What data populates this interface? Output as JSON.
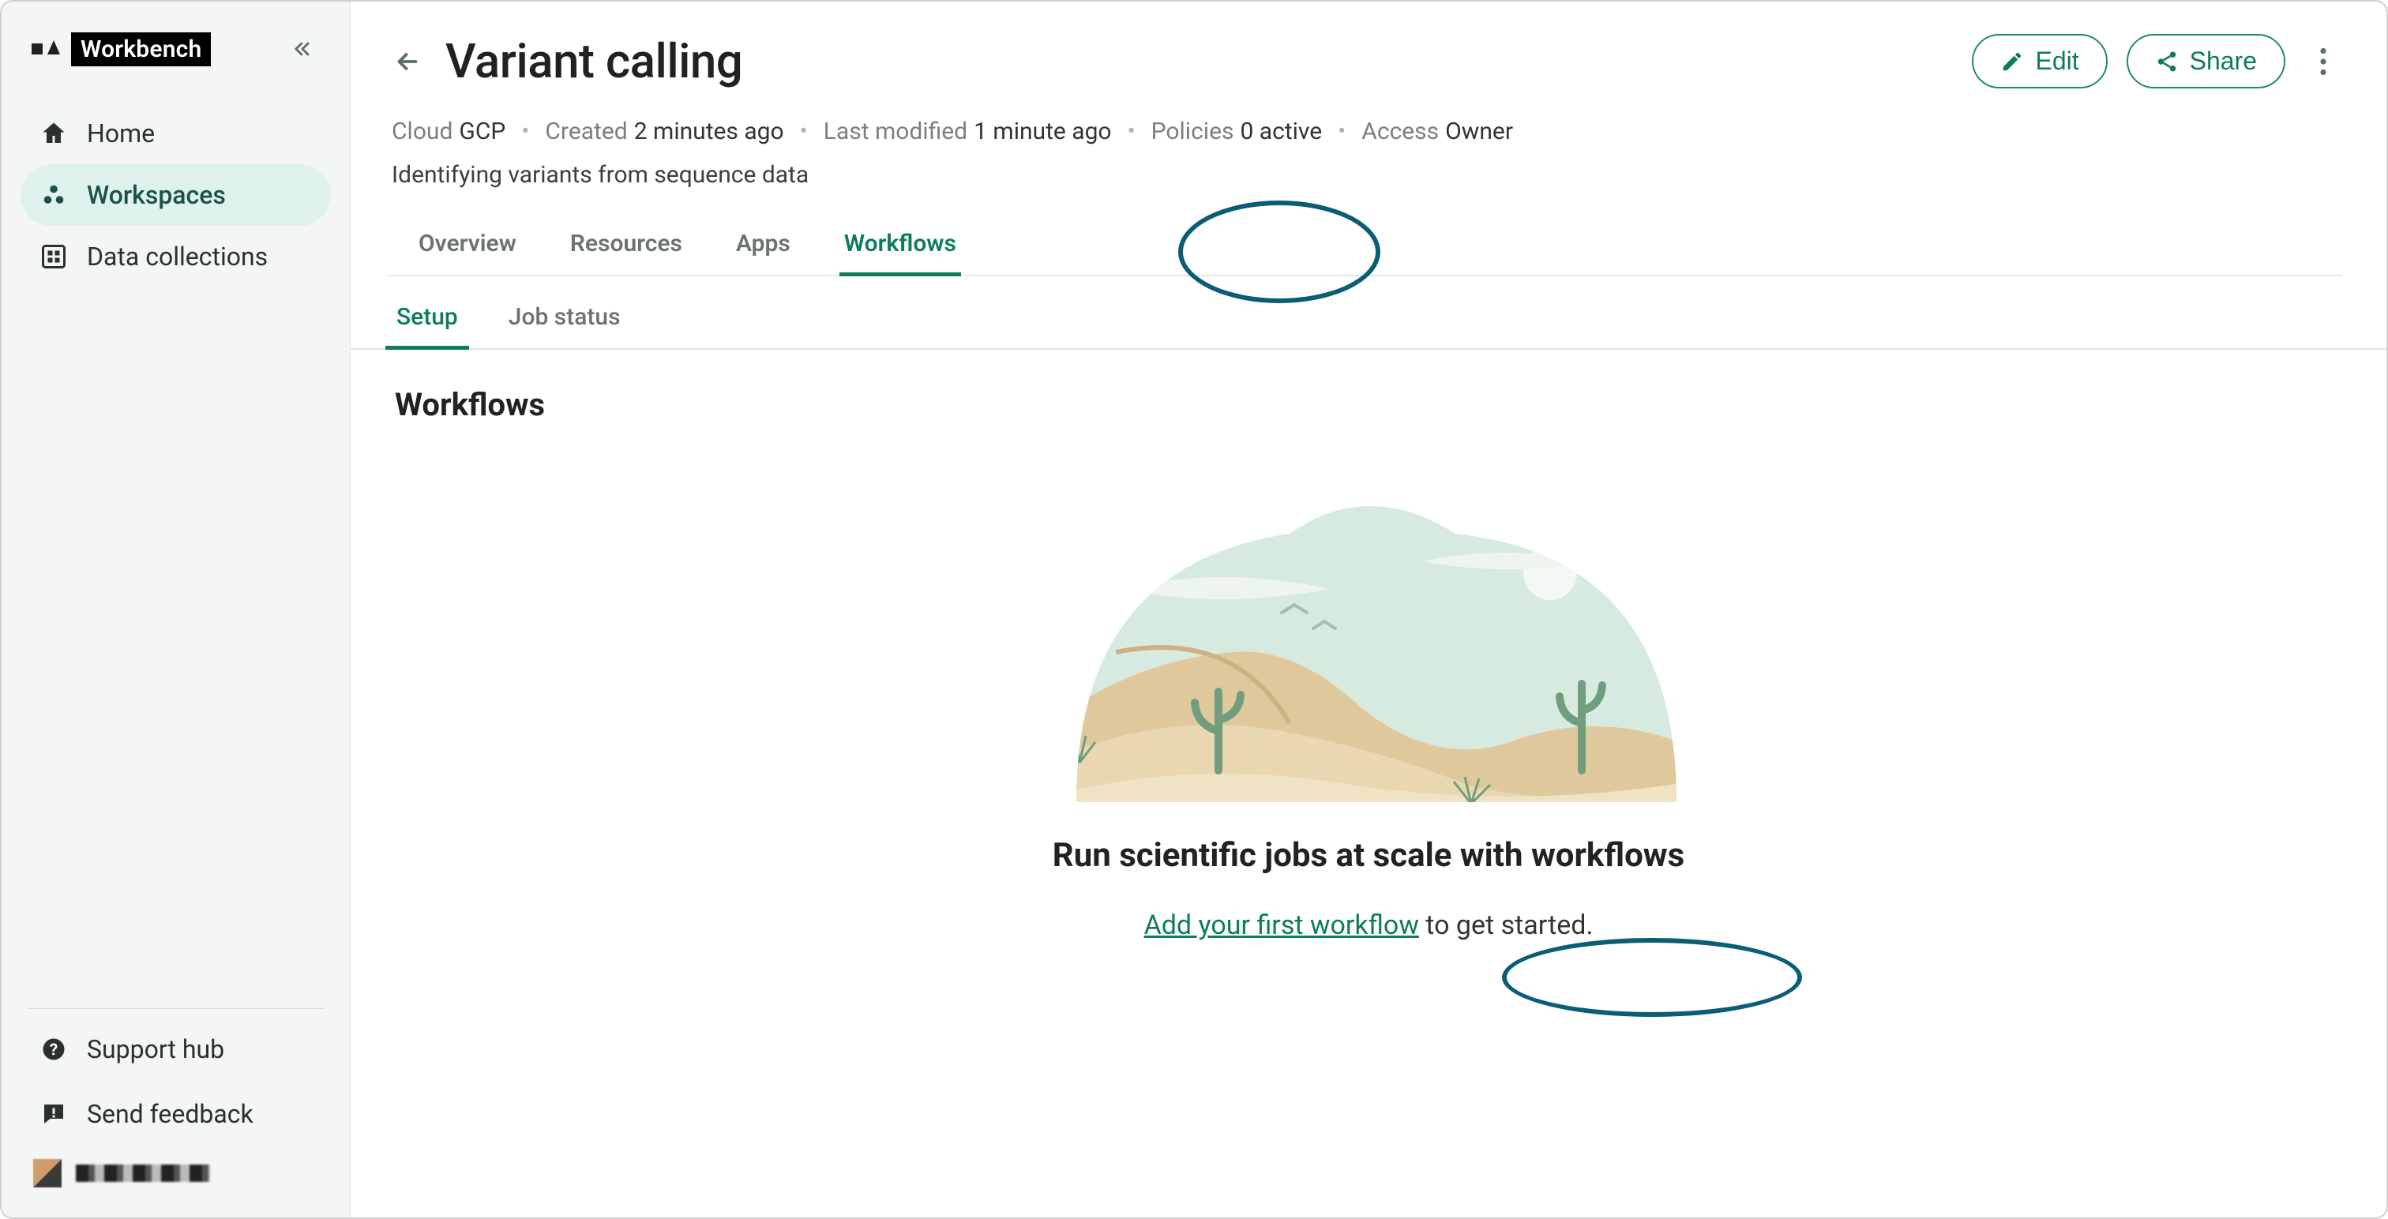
{
  "brand": {
    "badge": "Workbench"
  },
  "sidebar": {
    "items": [
      {
        "label": "Home",
        "icon": "home-icon",
        "active": false
      },
      {
        "label": "Workspaces",
        "icon": "workspaces-icon",
        "active": true
      },
      {
        "label": "Data collections",
        "icon": "grid-icon",
        "active": false
      }
    ],
    "bottom": [
      {
        "label": "Support hub",
        "icon": "help-icon"
      },
      {
        "label": "Send feedback",
        "icon": "feedback-icon"
      }
    ]
  },
  "header": {
    "title": "Variant calling",
    "edit_label": "Edit",
    "share_label": "Share"
  },
  "meta": {
    "cloud": {
      "label": "Cloud",
      "value": "GCP"
    },
    "created": {
      "label": "Created",
      "value": "2 minutes ago"
    },
    "modified": {
      "label": "Last modified",
      "value": "1 minute ago"
    },
    "policies": {
      "label": "Policies",
      "value": "0 active"
    },
    "access": {
      "label": "Access",
      "value": "Owner"
    }
  },
  "description": "Identifying variants from sequence data",
  "tabs_primary": [
    "Overview",
    "Resources",
    "Apps",
    "Workflows"
  ],
  "tabs_primary_active": "Workflows",
  "tabs_secondary": [
    "Setup",
    "Job status"
  ],
  "tabs_secondary_active": "Setup",
  "section": {
    "heading": "Workflows"
  },
  "empty": {
    "heading": "Run scientific jobs at scale with workflows",
    "link_text": "Add your first workflow",
    "tail_text": " to get started."
  },
  "colors": {
    "accent": "#0d7b5e",
    "sidebar_bg": "#f4f6f6",
    "annotation": "#0a5c77"
  }
}
